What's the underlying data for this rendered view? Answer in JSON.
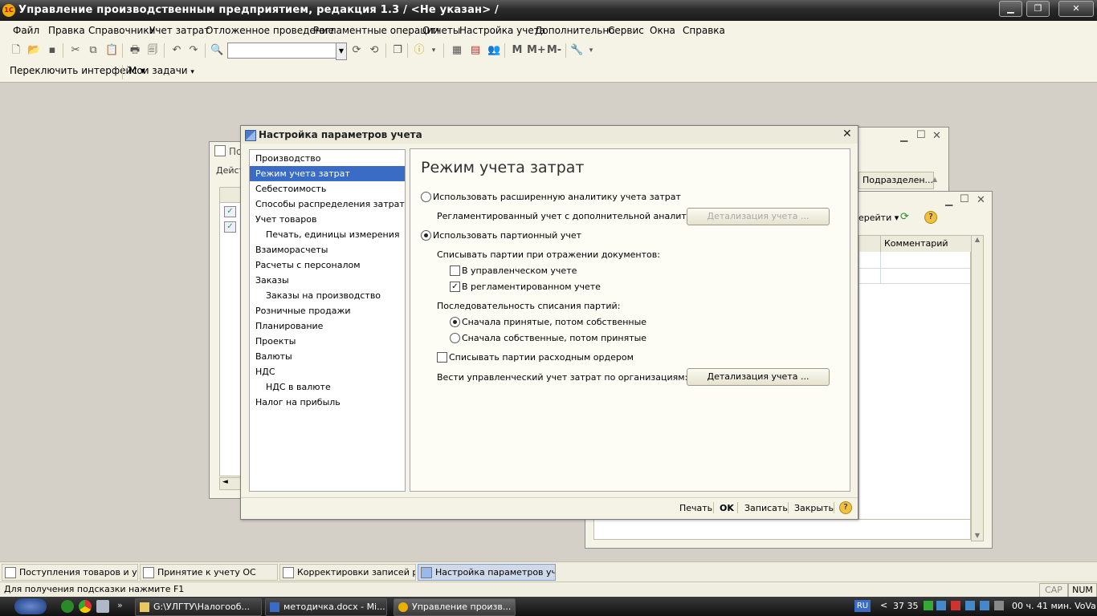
{
  "app": {
    "title": "Управление производственным предприятием, редакция 1.3 / <Не указан> /",
    "logo_text": "1С"
  },
  "menu": [
    "Файл",
    "Правка",
    "Справочники",
    "Учет затрат",
    "Отложенное проведение",
    "Регламентные операции",
    "Отчеты",
    "Настройка учета",
    "Дополнительно",
    "Сервис",
    "Окна",
    "Справка"
  ],
  "toolbar": {
    "memory_buttons": [
      "M",
      "M+",
      "M-"
    ],
    "search_value": ""
  },
  "panelbar": {
    "switch_interface": "Переключить интерфейс",
    "my_tasks": "Мои задачи"
  },
  "bg_windows": {
    "win1_title_fragment": "По",
    "win1_actions_fragment": "Дейст",
    "win2_column_subdivision": "Подразделен...",
    "win3_goto_fragment": "ерейти",
    "win3_column_comment": "Комментарий"
  },
  "dialog": {
    "title": "Настройка параметров учета",
    "nav_items": [
      {
        "label": "Производство",
        "indent": false,
        "selected": false
      },
      {
        "label": "Режим учета затрат",
        "indent": false,
        "selected": true
      },
      {
        "label": "Себестоимость",
        "indent": false,
        "selected": false
      },
      {
        "label": "Способы распределения затрат",
        "indent": false,
        "selected": false
      },
      {
        "label": "Учет товаров",
        "indent": false,
        "selected": false
      },
      {
        "label": "Печать, единицы измерения",
        "indent": true,
        "selected": false
      },
      {
        "label": "Взаиморасчеты",
        "indent": false,
        "selected": false
      },
      {
        "label": "Расчеты с персоналом",
        "indent": false,
        "selected": false
      },
      {
        "label": "Заказы",
        "indent": false,
        "selected": false
      },
      {
        "label": "Заказы на производство",
        "indent": true,
        "selected": false
      },
      {
        "label": "Розничные продажи",
        "indent": false,
        "selected": false
      },
      {
        "label": "Планирование",
        "indent": false,
        "selected": false
      },
      {
        "label": "Проекты",
        "indent": false,
        "selected": false
      },
      {
        "label": "Валюты",
        "indent": false,
        "selected": false
      },
      {
        "label": "НДС",
        "indent": false,
        "selected": false
      },
      {
        "label": "НДС в валюте",
        "indent": true,
        "selected": false
      },
      {
        "label": "Налог на прибыль",
        "indent": false,
        "selected": false
      }
    ],
    "panel": {
      "heading": "Режим учета затрат",
      "radio_extended": "Использовать расширенную аналитику учета затрат",
      "regl_extended": "Регламентированный учет с дополнительной аналитикой",
      "detail_button_disabled": "Детализация учета ...",
      "radio_party": "Использовать партионный учет",
      "write_off_title": "Списывать партии при отражении документов:",
      "chk_management": "В управленческом учете",
      "chk_regulated": "В регламентированном учете",
      "sequence_title": "Последовательность списания партий:",
      "radio_accepted_first": "Сначала принятые, потом собственные",
      "radio_own_first": "Сначала собственные, потом принятые",
      "chk_expense_order": "Списывать партии расходным ордером",
      "by_org_label": "Вести управленческий учет затрат по организациям:",
      "detail_button": "Детализация учета ..."
    },
    "footer": {
      "print": "Печать",
      "ok": "OK",
      "save": "Записать",
      "close": "Закрыть"
    },
    "state": {
      "mode": "party",
      "chk_management": false,
      "chk_regulated": true,
      "sequence": "accepted_first",
      "chk_expense_order": false
    }
  },
  "window_tabs": [
    {
      "label": "Поступления товаров и услуг",
      "active": false
    },
    {
      "label": "Принятие к учету ОС",
      "active": false
    },
    {
      "label": "Корректировки записей ре...",
      "active": false
    },
    {
      "label": "Настройка параметров учета",
      "active": true
    }
  ],
  "statusbar": {
    "hint": "Для получения подсказки нажмите F1",
    "cap": "CAP",
    "num": "NUM"
  },
  "os_taskbar": {
    "tasks": [
      "G:\\УЛГТУ\\Налогооб...",
      "методичка.docx - Mi...",
      "Управление произв..."
    ],
    "lang": "RU",
    "tray_text": "37 35",
    "clock": "00 ч. 41 мин. VoVa"
  }
}
